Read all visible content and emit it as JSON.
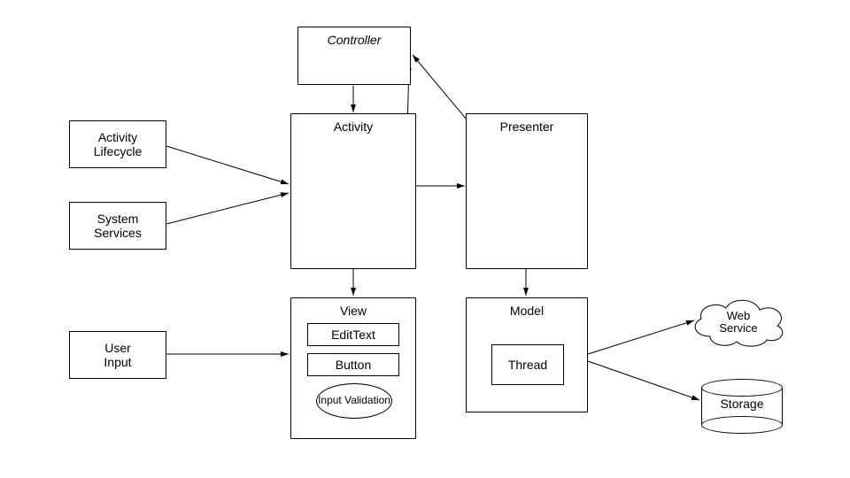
{
  "boxes": {
    "controller": "Controller",
    "activity": "Activity",
    "presenter": "Presenter",
    "model": "Model",
    "view": "View",
    "activityLifecycle": "Activity\nLifecycle",
    "systemServices": "System\nServices",
    "userInput": "User\nInput",
    "editText": "EditText",
    "button": "Button",
    "inputValidation": "Input\nValidation",
    "thread": "Thread",
    "webService": "Web\nService",
    "storage": "Storage"
  }
}
